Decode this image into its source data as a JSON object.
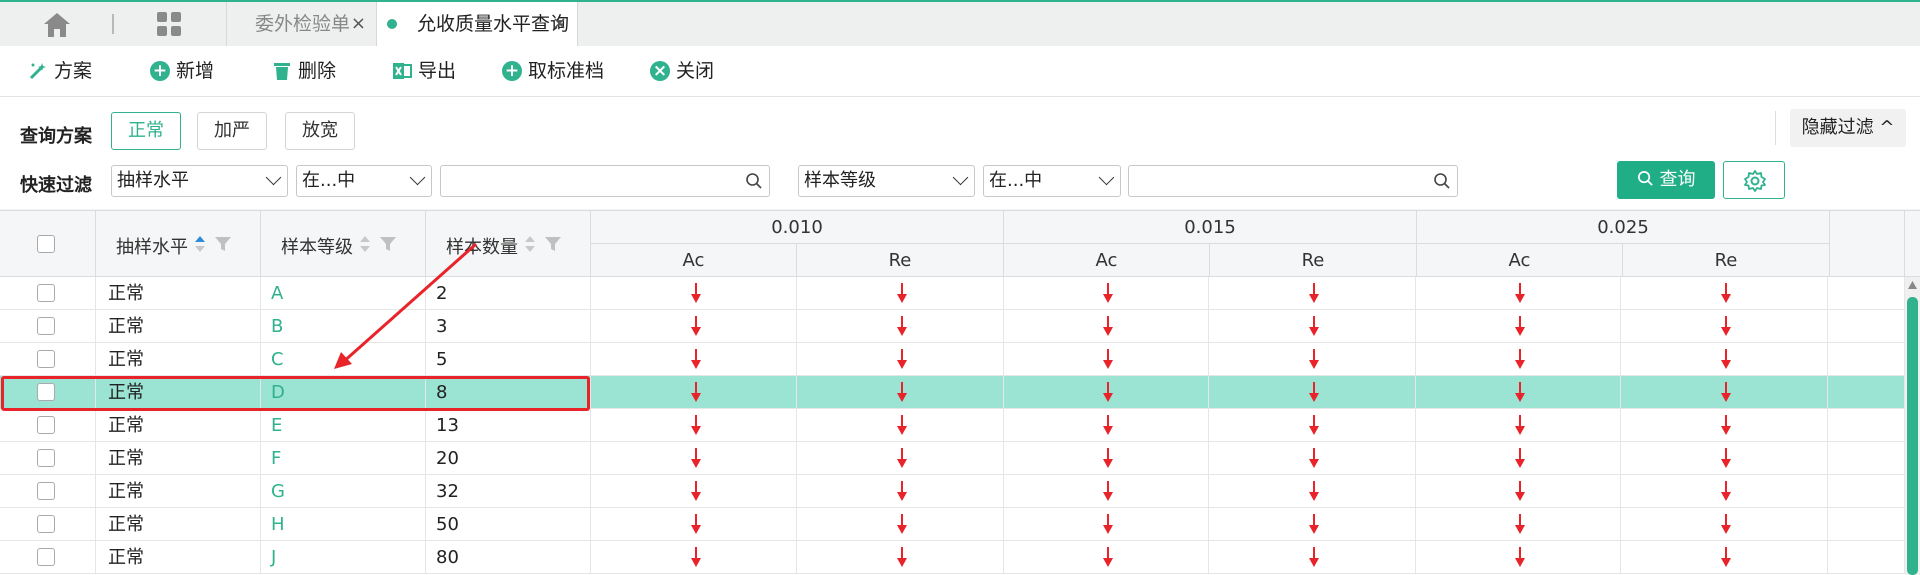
{
  "tabs": [
    {
      "label": "委外检验单",
      "close": "×"
    },
    {
      "label": "允收质量水平查询",
      "close": "×"
    }
  ],
  "toolbar": {
    "scheme": "方案",
    "add": "新增",
    "delete": "删除",
    "export": "导出",
    "cancel_standard": "取标准档",
    "close": "关闭"
  },
  "query_scheme": {
    "label": "查询方案",
    "options": [
      "正常",
      "加严",
      "放宽"
    ],
    "selected": "正常"
  },
  "hide_filter": "隐藏过滤 ^",
  "quick_filter": {
    "label": "快速过滤",
    "field1": "抽样水平",
    "op1": "在...中",
    "value1": "",
    "field2": "样本等级",
    "op2": "在...中",
    "value2": "",
    "query_button": "查询"
  },
  "grid": {
    "columns": [
      "抽样水平",
      "样本等级",
      "样本数量"
    ],
    "groups": [
      "0.010",
      "0.015",
      "0.025"
    ],
    "sub": [
      "Ac",
      "Re"
    ],
    "rows": [
      {
        "level": "正常",
        "code": "A",
        "qty": "2"
      },
      {
        "level": "正常",
        "code": "B",
        "qty": "3"
      },
      {
        "level": "正常",
        "code": "C",
        "qty": "5"
      },
      {
        "level": "正常",
        "code": "D",
        "qty": "8"
      },
      {
        "level": "正常",
        "code": "E",
        "qty": "13"
      },
      {
        "level": "正常",
        "code": "F",
        "qty": "20"
      },
      {
        "level": "正常",
        "code": "G",
        "qty": "32"
      },
      {
        "level": "正常",
        "code": "H",
        "qty": "50"
      },
      {
        "level": "正常",
        "code": "J",
        "qty": "80"
      }
    ],
    "selected_row": 3
  },
  "colors": {
    "accent": "#2fb28d",
    "selected_row": "#9be3d2",
    "arrow": "#e8232a"
  }
}
